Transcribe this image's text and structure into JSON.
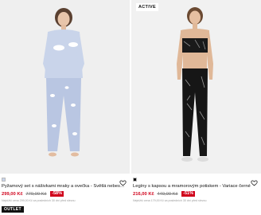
{
  "products": [
    {
      "title": "Pyžamový set s nášivkami mraky a ovečka - Světlá nebesk…",
      "price_now": "299,00 Kč",
      "price_old": "779,00 Kč",
      "discount": "-58%",
      "lowest_price_note": "Nejnižší cena 299,00 Kč za posledních 30 dní před slevou",
      "swatch_color": "#c9d4ea",
      "badge_outlet": "OUTLET",
      "icon": "heart-icon"
    },
    {
      "badge_top": "ACTIVE",
      "title": "Legíny s kapsou a mramorovým potiskem - Variace černé",
      "price_now": "216,00 Kč",
      "price_old": "449,00 Kč",
      "discount": "-51%",
      "lowest_price_note": "Nejnižší cena 179,00 Kč za posledních 30 dní před slevou",
      "swatch_color": "#111111",
      "icon": "heart-icon"
    }
  ],
  "colors": {
    "sale_red": "#d0021b"
  }
}
